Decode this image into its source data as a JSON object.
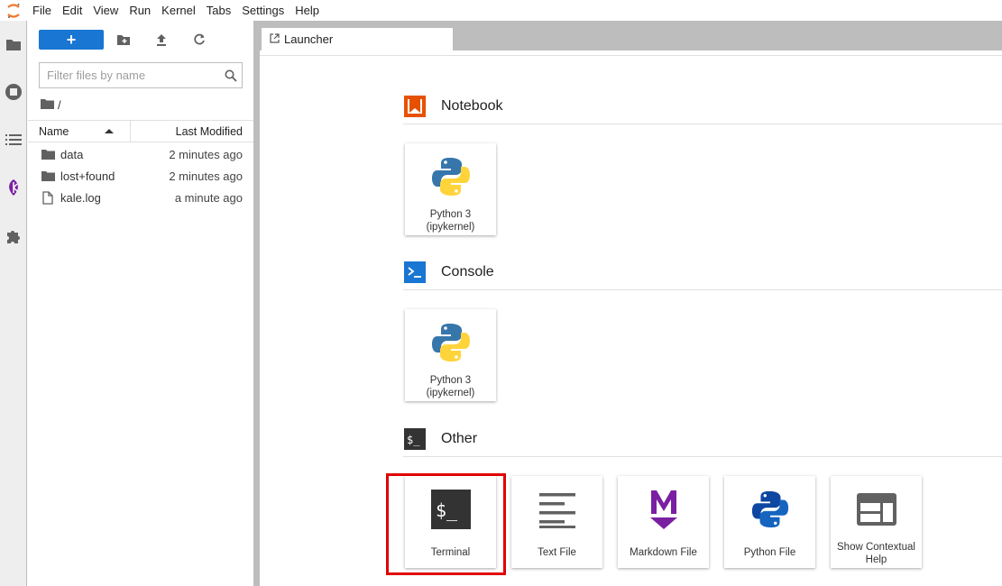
{
  "menubar": {
    "items": [
      "File",
      "Edit",
      "View",
      "Run",
      "Kernel",
      "Tabs",
      "Settings",
      "Help"
    ]
  },
  "filebrowser": {
    "new_label": "+",
    "filter_placeholder": "Filter files by name",
    "breadcrumb": "/",
    "columns": {
      "name": "Name",
      "modified": "Last Modified"
    },
    "files": [
      {
        "name": "data",
        "type": "folder",
        "modified": "2 minutes ago"
      },
      {
        "name": "lost+found",
        "type": "folder",
        "modified": "2 minutes ago"
      },
      {
        "name": "kale.log",
        "type": "file",
        "modified": "a minute ago"
      }
    ]
  },
  "tabs": [
    {
      "label": "Launcher"
    }
  ],
  "launcher": {
    "sections": [
      {
        "title": "Notebook",
        "cards": [
          {
            "label_line1": "Python 3",
            "label_line2": "(ipykernel)"
          }
        ]
      },
      {
        "title": "Console",
        "cards": [
          {
            "label_line1": "Python 3",
            "label_line2": "(ipykernel)"
          }
        ]
      },
      {
        "title": "Other",
        "cards": [
          {
            "label_line1": "Terminal"
          },
          {
            "label_line1": "Text File"
          },
          {
            "label_line1": "Markdown File"
          },
          {
            "label_line1": "Python File"
          },
          {
            "label_line1": "Show Contextual",
            "label_line2": "Help"
          }
        ]
      }
    ]
  },
  "colors": {
    "accent": "#1976d2",
    "notebook_icon": "#e65100",
    "console_icon": "#1976d2",
    "other_icon": "#333333",
    "markdown_icon": "#7b1fa2",
    "highlight": "#e00000"
  }
}
